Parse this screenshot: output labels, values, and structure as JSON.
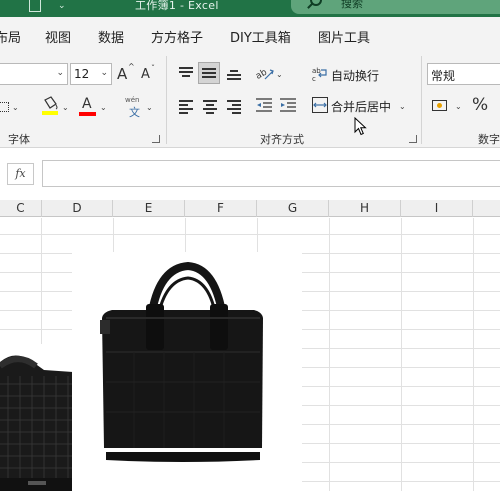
{
  "titlebar": {
    "title": "工作簿1  -  Excel",
    "search_label": "搜索"
  },
  "tabs": [
    "布局",
    "视图",
    "数据",
    "方方格子",
    "DIY工具箱",
    "图片工具"
  ],
  "ribbon": {
    "font": {
      "size_value": "12",
      "increase_label": "A",
      "decrease_label": "A",
      "font_color_label": "A",
      "phonetic_label": "文",
      "phonetic_top": "wén",
      "group_label": "字体"
    },
    "alignment": {
      "wrap_text_label": "自动换行",
      "merge_center_label": "合并后居中",
      "group_label": "对齐方式"
    },
    "number": {
      "format_value": "常规",
      "percent_label": "%",
      "group_label": "数字"
    }
  },
  "formula_bar": {
    "fx_label": "fx",
    "value": ""
  },
  "columns": [
    "C",
    "D",
    "E",
    "F",
    "G",
    "H",
    "I"
  ],
  "colors": {
    "excel_green": "#217346",
    "search_box": "#5fa47b",
    "highlight_yellow": "#ffff00",
    "font_red": "#ff0000",
    "bag_black": "#141414"
  }
}
